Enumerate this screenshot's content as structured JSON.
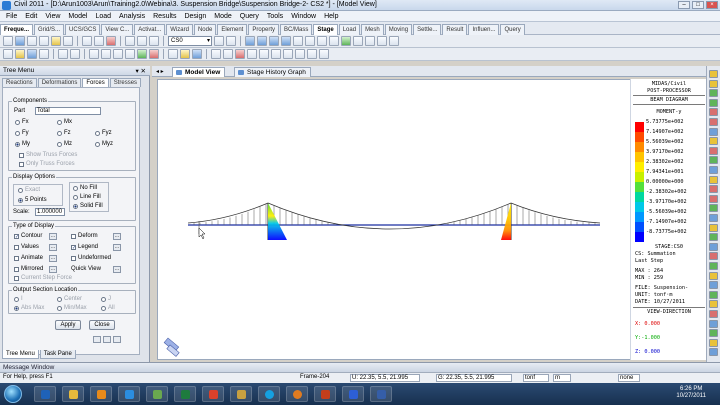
{
  "window": {
    "title": "Civil 2011 - [D:\\Arun1003\\Arun\\Training2.0\\Webina\\3. Suspension Bridge\\Suspension Bridge-2- CS2 *] - [Model View]",
    "controls": [
      "–",
      "□",
      "×"
    ]
  },
  "menu": [
    "File",
    "Edit",
    "View",
    "Model",
    "Load",
    "Analysis",
    "Results",
    "Design",
    "Mode",
    "Query",
    "Tools",
    "Window",
    "Help"
  ],
  "ribbon_tabs": [
    "Freque...",
    "Grid/S...",
    "UCS/GCS",
    "View C...",
    "Activat...",
    "Wizard",
    "Node",
    "Element",
    "Property",
    "BC/Mass",
    "Stage",
    "Load",
    "Mesh",
    "Moving",
    "Settle...",
    "Result",
    "Influen...",
    "Query"
  ],
  "toolbar": {
    "stage_select": "CS0"
  },
  "left_panel": {
    "title": "Tree Menu",
    "pin": "▾ ✕",
    "tabs": [
      "Reactions",
      "Deformations",
      "Forces",
      "Stresses"
    ],
    "active_tab": "Forces",
    "components": {
      "title": "Components",
      "part_label": "Part",
      "part_value": "Total",
      "radios": [
        "Fx",
        "Mx",
        "Fy",
        "Fz",
        "Fyz",
        "My",
        "Mz",
        "Myz"
      ],
      "show_truss": "Show Truss Forces",
      "only_truss": "Only Truss Forces"
    },
    "display_options": {
      "title": "Display Options",
      "exact": "Exact",
      "five_points": "5 Points",
      "no_fill": "No Fill",
      "line_fill": "Line Fill",
      "solid_fill": "Solid Fill",
      "scale_label": "Scale:",
      "scale_value": "1.000000"
    },
    "type_of_display": {
      "title": "Type of Display",
      "contour": "Contour",
      "values": "Values",
      "animate": "Animate",
      "mirrored": "Mirrored",
      "deform": "Deform",
      "legend": "Legend",
      "undeformed": "Undeformed",
      "quick_view": "Quick View",
      "current_step": "Current Step Force"
    },
    "output_section": {
      "title": "Output Section Location",
      "i": "I",
      "center": "Center",
      "j": "J",
      "abs_max": "Abs Max",
      "min_max": "Min/Max",
      "all": "All"
    },
    "apply": "Apply",
    "close": "Close",
    "bottom_tabs": [
      "Tree Menu",
      "Task Pane"
    ]
  },
  "view_tabs": [
    "Model View",
    "Stage History Graph"
  ],
  "legend": {
    "header1": "MIDAS/Civil",
    "header2": "POST-PROCESSOR",
    "header3": "BEAM DIAGRAM",
    "component": "MOMENT-y",
    "values": [
      "5.73775e+002",
      "7.14907e+002",
      "5.56039e+002",
      "3.97170e+002",
      "2.38302e+002",
      "7.94341e+001",
      "0.00000e+000",
      "-2.38302e+002",
      "-3.97170e+002",
      "-5.56039e+002",
      "-7.14907e+002",
      "-8.73775e+002"
    ],
    "colors": [
      "#ff0000",
      "#ff4a00",
      "#ff8a00",
      "#ffc400",
      "#ffee00",
      "#c8f000",
      "#53e03b",
      "#00d8a0",
      "#00c8e8",
      "#0098ff",
      "#0050ff",
      "#0000ff"
    ],
    "stage": "STAGE:CS0",
    "cs": "CS: Summation",
    "step": "Last Step",
    "max": "MAX : 264",
    "min": "MIN : 259",
    "file": "FILE: Suspension-",
    "unit": "UNIT: tonf·m",
    "date": "DATE: 10/27/2011",
    "view_dir": "VIEW-DIRECTION",
    "vx": "X: 0.000",
    "vy": "Y:-1.000",
    "vz": "Z: 0.000"
  },
  "message_window": "Message Window",
  "status": {
    "help": "For Help, press F1",
    "frame": "Frame-204",
    "u": "U: 22.35, 5.5, 21.995",
    "g": "G: 22.35, 5.5, 21.995",
    "unit_force": "tonf",
    "unit_len": "m",
    "mode": "none"
  },
  "taskbar": {
    "time": "6:26 PM",
    "date": "10/27/2011"
  }
}
